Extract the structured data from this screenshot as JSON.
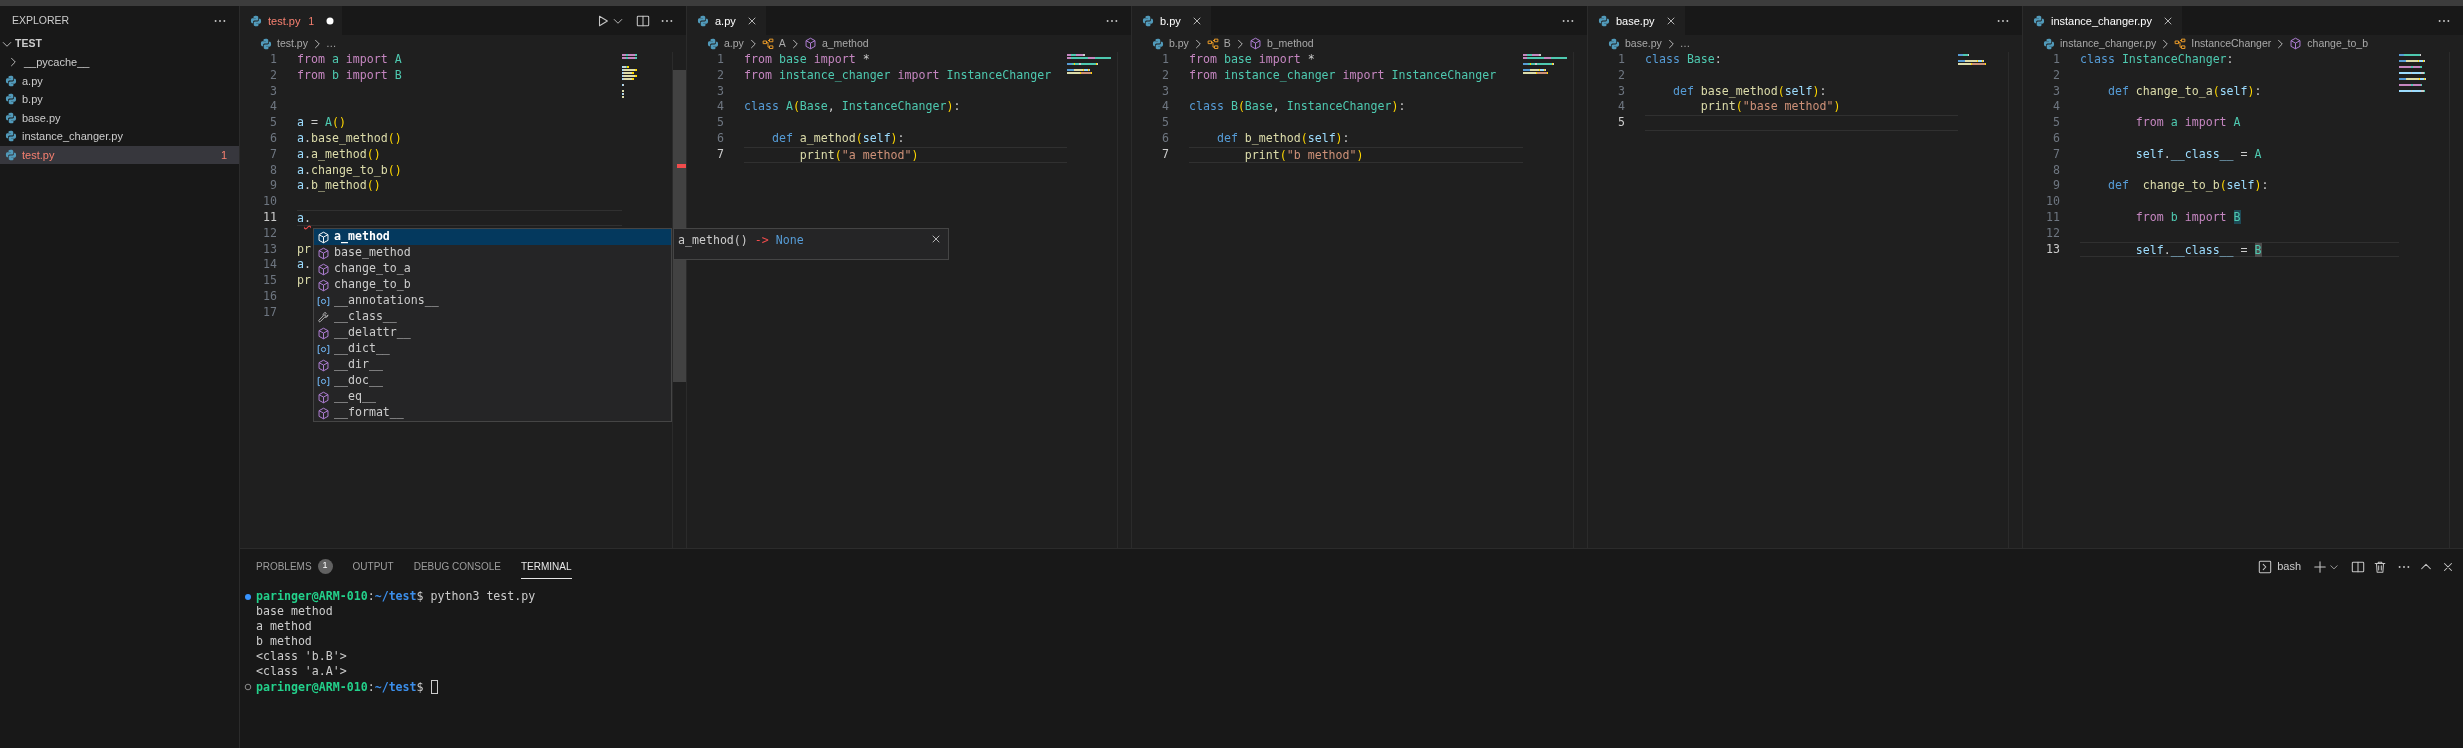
{
  "sidebar": {
    "title": "EXPLORER",
    "folder": {
      "label": "TEST",
      "expanded": true,
      "children": [
        {
          "label": "__pycache__",
          "kind": "folder",
          "expanded": false,
          "selected": false,
          "has_error": false
        },
        {
          "label": "a.py",
          "kind": "python",
          "selected": false,
          "has_error": false
        },
        {
          "label": "b.py",
          "kind": "python",
          "selected": false,
          "has_error": false
        },
        {
          "label": "base.py",
          "kind": "python",
          "selected": false,
          "has_error": false
        },
        {
          "label": "instance_changer.py",
          "kind": "python",
          "selected": false,
          "has_error": false
        },
        {
          "label": "test.py",
          "kind": "python",
          "selected": true,
          "has_error": true,
          "badge": "1"
        }
      ]
    }
  },
  "editor_groups": [
    {
      "active": true,
      "tab": {
        "label": "test.py",
        "selected": true,
        "dirty": true,
        "has_error": true,
        "badge": "1"
      },
      "breadcrumbs": [
        {
          "kind": "file",
          "text": "test.py"
        },
        {
          "kind": "ellipsis",
          "text": "…"
        }
      ],
      "lines": [
        {
          "number": "1",
          "current": false,
          "tokens": [
            {
              "text": "from",
              "kind": "kw"
            },
            {
              "text": " a",
              "kind": "mod"
            },
            {
              "text": " import",
              "kind": "kw"
            },
            {
              "text": " A",
              "kind": "cls"
            }
          ]
        },
        {
          "number": "2",
          "current": false,
          "tokens": [
            {
              "text": "from",
              "kind": "kw"
            },
            {
              "text": " b",
              "kind": "mod"
            },
            {
              "text": " import",
              "kind": "kw"
            },
            {
              "text": " B",
              "kind": "cls"
            }
          ]
        },
        {
          "number": "3",
          "current": false
        },
        {
          "number": "4",
          "current": false
        },
        {
          "number": "5",
          "current": false,
          "tokens": [
            {
              "text": "a",
              "kind": "var"
            },
            {
              "text": " = ",
              "kind": "plain"
            },
            {
              "text": "A",
              "kind": "cls"
            },
            {
              "text": "()",
              "kind": "paren"
            }
          ]
        },
        {
          "number": "6",
          "current": false,
          "tokens": [
            {
              "text": "a",
              "kind": "var"
            },
            {
              "text": ".",
              "kind": "plain"
            },
            {
              "text": "base_method",
              "kind": "fn"
            },
            {
              "text": "()",
              "kind": "paren"
            }
          ]
        },
        {
          "number": "7",
          "current": false,
          "tokens": [
            {
              "text": "a",
              "kind": "var"
            },
            {
              "text": ".",
              "kind": "plain"
            },
            {
              "text": "a_method",
              "kind": "fn"
            },
            {
              "text": "()",
              "kind": "paren"
            }
          ]
        },
        {
          "number": "8",
          "current": false,
          "tokens": [
            {
              "text": "a",
              "kind": "var"
            },
            {
              "text": ".",
              "kind": "plain"
            },
            {
              "text": "change_to_b",
              "kind": "fn"
            },
            {
              "text": "()",
              "kind": "paren"
            }
          ]
        },
        {
          "number": "9",
          "current": false,
          "tokens": [
            {
              "text": "a",
              "kind": "var"
            },
            {
              "text": ".",
              "kind": "plain"
            },
            {
              "text": "b_method",
              "kind": "fn"
            },
            {
              "text": "()",
              "kind": "paren"
            }
          ]
        },
        {
          "number": "10",
          "current": false
        },
        {
          "number": "11",
          "current": true,
          "tokens": [
            {
              "text": "a",
              "kind": "var"
            },
            {
              "text": ".",
              "kind": "err"
            }
          ]
        },
        {
          "number": "12",
          "current": false
        },
        {
          "number": "13",
          "current": false,
          "tokens": [
            {
              "text": "pr",
              "kind": "fn"
            }
          ]
        },
        {
          "number": "14",
          "current": false,
          "tokens": [
            {
              "text": "a",
              "kind": "var"
            },
            {
              "text": ".",
              "kind": "plain"
            }
          ]
        },
        {
          "number": "15",
          "current": false,
          "tokens": [
            {
              "text": "pr",
              "kind": "fn"
            }
          ]
        },
        {
          "number": "16",
          "current": false
        },
        {
          "number": "17",
          "current": false
        }
      ],
      "suggest": {
        "items": [
          {
            "label": "a_method",
            "kind": "method",
            "selected": true
          },
          {
            "label": "base_method",
            "kind": "method",
            "selected": false
          },
          {
            "label": "change_to_a",
            "kind": "method",
            "selected": false
          },
          {
            "label": "change_to_b",
            "kind": "method",
            "selected": false
          },
          {
            "label": "__annotations__",
            "kind": "field",
            "selected": false
          },
          {
            "label": "__class__",
            "kind": "property",
            "selected": false
          },
          {
            "label": "__delattr__",
            "kind": "method",
            "selected": false
          },
          {
            "label": "__dict__",
            "kind": "field",
            "selected": false
          },
          {
            "label": "__dir__",
            "kind": "method",
            "selected": false
          },
          {
            "label": "__doc__",
            "kind": "field",
            "selected": false
          },
          {
            "label": "__eq__",
            "kind": "method",
            "selected": false
          },
          {
            "label": "__format__",
            "kind": "method",
            "selected": false
          }
        ],
        "detail": {
          "signature": "a_method()",
          "arrow": "->",
          "type": "None"
        }
      }
    },
    {
      "active": false,
      "tab": {
        "label": "a.py",
        "selected": true,
        "dirty": false,
        "has_error": false
      },
      "breadcrumbs": [
        {
          "kind": "file",
          "text": "a.py"
        },
        {
          "kind": "class",
          "text": "A"
        },
        {
          "kind": "method",
          "text": "a_method"
        }
      ],
      "lines": [
        {
          "number": "1",
          "current": false,
          "tokens": [
            {
              "text": "from",
              "kind": "kw"
            },
            {
              "text": " base",
              "kind": "mod"
            },
            {
              "text": " import",
              "kind": "kw"
            },
            {
              "text": " *",
              "kind": "plain"
            }
          ]
        },
        {
          "number": "2",
          "current": false,
          "tokens": [
            {
              "text": "from",
              "kind": "kw"
            },
            {
              "text": " instance_changer",
              "kind": "mod"
            },
            {
              "text": " import",
              "kind": "kw"
            },
            {
              "text": " InstanceChanger",
              "kind": "cls"
            }
          ]
        },
        {
          "number": "3",
          "current": false
        },
        {
          "number": "4",
          "current": false,
          "tokens": [
            {
              "text": "class",
              "kind": "def"
            },
            {
              "text": " A",
              "kind": "cls"
            },
            {
              "text": "(",
              "kind": "paren"
            },
            {
              "text": "Base",
              "kind": "cls"
            },
            {
              "text": ", ",
              "kind": "plain"
            },
            {
              "text": "InstanceChanger",
              "kind": "cls"
            },
            {
              "text": ")",
              "kind": "paren"
            },
            {
              "text": ":",
              "kind": "plain"
            }
          ]
        },
        {
          "number": "5",
          "current": false
        },
        {
          "number": "6",
          "current": false,
          "tokens": [
            {
              "text": "    def",
              "kind": "def"
            },
            {
              "text": " a_method",
              "kind": "fn"
            },
            {
              "text": "(",
              "kind": "paren"
            },
            {
              "text": "self",
              "kind": "var"
            },
            {
              "text": ")",
              "kind": "paren"
            },
            {
              "text": ":",
              "kind": "plain"
            }
          ]
        },
        {
          "number": "7",
          "current": true,
          "tokens": [
            {
              "text": "        print",
              "kind": "fn"
            },
            {
              "text": "(",
              "kind": "paren"
            },
            {
              "text": "\"a method\"",
              "kind": "str"
            },
            {
              "text": ")",
              "kind": "paren"
            }
          ]
        }
      ]
    },
    {
      "active": false,
      "tab": {
        "label": "b.py",
        "selected": true,
        "dirty": false,
        "has_error": false
      },
      "breadcrumbs": [
        {
          "kind": "file",
          "text": "b.py"
        },
        {
          "kind": "class",
          "text": "B"
        },
        {
          "kind": "method",
          "text": "b_method"
        }
      ],
      "lines": [
        {
          "number": "1",
          "current": false,
          "tokens": [
            {
              "text": "from",
              "kind": "kw"
            },
            {
              "text": " base",
              "kind": "mod"
            },
            {
              "text": " import",
              "kind": "kw"
            },
            {
              "text": " *",
              "kind": "plain"
            }
          ]
        },
        {
          "number": "2",
          "current": false,
          "tokens": [
            {
              "text": "from",
              "kind": "kw"
            },
            {
              "text": " instance_changer",
              "kind": "mod"
            },
            {
              "text": " import",
              "kind": "kw"
            },
            {
              "text": " InstanceChanger",
              "kind": "cls"
            }
          ]
        },
        {
          "number": "3",
          "current": false
        },
        {
          "number": "4",
          "current": false,
          "tokens": [
            {
              "text": "class",
              "kind": "def"
            },
            {
              "text": " B",
              "kind": "cls"
            },
            {
              "text": "(",
              "kind": "paren"
            },
            {
              "text": "Base",
              "kind": "cls"
            },
            {
              "text": ", ",
              "kind": "plain"
            },
            {
              "text": "InstanceChanger",
              "kind": "cls"
            },
            {
              "text": ")",
              "kind": "paren"
            },
            {
              "text": ":",
              "kind": "plain"
            }
          ]
        },
        {
          "number": "5",
          "current": false
        },
        {
          "number": "6",
          "current": false,
          "tokens": [
            {
              "text": "    def",
              "kind": "def"
            },
            {
              "text": " b_method",
              "kind": "fn"
            },
            {
              "text": "(",
              "kind": "paren"
            },
            {
              "text": "self",
              "kind": "var"
            },
            {
              "text": ")",
              "kind": "paren"
            },
            {
              "text": ":",
              "kind": "plain"
            }
          ]
        },
        {
          "number": "7",
          "current": true,
          "tokens": [
            {
              "text": "        print",
              "kind": "fn"
            },
            {
              "text": "(",
              "kind": "paren"
            },
            {
              "text": "\"b method\"",
              "kind": "str"
            },
            {
              "text": ")",
              "kind": "paren"
            }
          ]
        }
      ]
    },
    {
      "active": false,
      "tab": {
        "label": "base.py",
        "selected": true,
        "dirty": false,
        "has_error": false
      },
      "breadcrumbs": [
        {
          "kind": "file",
          "text": "base.py"
        },
        {
          "kind": "ellipsis",
          "text": "…"
        }
      ],
      "lines": [
        {
          "number": "1",
          "current": false,
          "tokens": [
            {
              "text": "class",
              "kind": "def"
            },
            {
              "text": " Base",
              "kind": "cls"
            },
            {
              "text": ":",
              "kind": "plain"
            }
          ]
        },
        {
          "number": "2",
          "current": false
        },
        {
          "number": "3",
          "current": false,
          "tokens": [
            {
              "text": "    def",
              "kind": "def"
            },
            {
              "text": " base_method",
              "kind": "fn"
            },
            {
              "text": "(",
              "kind": "paren"
            },
            {
              "text": "self",
              "kind": "var"
            },
            {
              "text": ")",
              "kind": "paren"
            },
            {
              "text": ":",
              "kind": "plain"
            }
          ]
        },
        {
          "number": "4",
          "current": false,
          "tokens": [
            {
              "text": "        print",
              "kind": "fn"
            },
            {
              "text": "(",
              "kind": "paren"
            },
            {
              "text": "\"base method\"",
              "kind": "str"
            },
            {
              "text": ")",
              "kind": "paren"
            }
          ]
        },
        {
          "number": "5",
          "current": true
        }
      ]
    },
    {
      "active": false,
      "tab": {
        "label": "instance_changer.py",
        "selected": true,
        "dirty": false,
        "has_error": false
      },
      "breadcrumbs": [
        {
          "kind": "file",
          "text": "instance_changer.py"
        },
        {
          "kind": "class",
          "text": "InstanceChanger"
        },
        {
          "kind": "method",
          "text": "change_to_b"
        }
      ],
      "lines": [
        {
          "number": "1",
          "current": false,
          "tokens": [
            {
              "text": "class",
              "kind": "def"
            },
            {
              "text": " InstanceChanger",
              "kind": "cls"
            },
            {
              "text": ":",
              "kind": "plain"
            }
          ]
        },
        {
          "number": "2",
          "current": false
        },
        {
          "number": "3",
          "current": false,
          "tokens": [
            {
              "text": "    def",
              "kind": "def"
            },
            {
              "text": " change_to_a",
              "kind": "fn"
            },
            {
              "text": "(",
              "kind": "paren"
            },
            {
              "text": "self",
              "kind": "var"
            },
            {
              "text": ")",
              "kind": "paren"
            },
            {
              "text": ":",
              "kind": "plain"
            }
          ]
        },
        {
          "number": "4",
          "current": false
        },
        {
          "number": "5",
          "current": false,
          "tokens": [
            {
              "text": "        from",
              "kind": "kw"
            },
            {
              "text": " a",
              "kind": "mod"
            },
            {
              "text": " import",
              "kind": "kw"
            },
            {
              "text": " A",
              "kind": "cls"
            }
          ]
        },
        {
          "number": "6",
          "current": false
        },
        {
          "number": "7",
          "current": false,
          "tokens": [
            {
              "text": "        self",
              "kind": "var"
            },
            {
              "text": ".",
              "kind": "plain"
            },
            {
              "text": "__class__",
              "kind": "var"
            },
            {
              "text": " = ",
              "kind": "plain"
            },
            {
              "text": "A",
              "kind": "cls"
            }
          ]
        },
        {
          "number": "8",
          "current": false
        },
        {
          "number": "9",
          "current": false,
          "tokens": [
            {
              "text": "    def",
              "kind": "def"
            },
            {
              "text": "  change_to_b",
              "kind": "fn"
            },
            {
              "text": "(",
              "kind": "paren"
            },
            {
              "text": "self",
              "kind": "var"
            },
            {
              "text": ")",
              "kind": "paren"
            },
            {
              "text": ":",
              "kind": "plain"
            }
          ]
        },
        {
          "number": "10",
          "current": false
        },
        {
          "number": "11",
          "current": false,
          "tokens": [
            {
              "text": "        from",
              "kind": "kw"
            },
            {
              "text": " b",
              "kind": "mod"
            },
            {
              "text": " import ",
              "kind": "kw"
            },
            {
              "text": "B",
              "kind": "cls_match"
            }
          ]
        },
        {
          "number": "12",
          "current": false
        },
        {
          "number": "13",
          "current": true,
          "tokens": [
            {
              "text": "        self",
              "kind": "var"
            },
            {
              "text": ".",
              "kind": "plain"
            },
            {
              "text": "__class__",
              "kind": "var"
            },
            {
              "text": " = ",
              "kind": "plain"
            },
            {
              "text": "B",
              "kind": "cls_cursor"
            }
          ]
        }
      ]
    }
  ],
  "panel": {
    "tabs": [
      {
        "label": "PROBLEMS",
        "selected": false,
        "badge": "1"
      },
      {
        "label": "OUTPUT",
        "selected": false
      },
      {
        "label": "DEBUG CONSOLE",
        "selected": false
      },
      {
        "label": "TERMINAL",
        "selected": true
      }
    ],
    "shell": "bash",
    "terminal": [
      {
        "kind": "prompt",
        "succeeded": true,
        "user": "paringer@ARM-010",
        "separator": ":",
        "path": "~/test",
        "symbol": "$",
        "command": "python3 test.py",
        "cursor": false
      },
      {
        "kind": "output",
        "text": "base method"
      },
      {
        "kind": "output",
        "text": "a method"
      },
      {
        "kind": "output",
        "text": "b method"
      },
      {
        "kind": "output",
        "text": "<class 'b.B'>"
      },
      {
        "kind": "output",
        "text": "<class 'a.A'>"
      },
      {
        "kind": "prompt",
        "succeeded": false,
        "user": "paringer@ARM-010",
        "separator": ":",
        "path": "~/test",
        "symbol": "$",
        "cursor": true
      }
    ]
  }
}
